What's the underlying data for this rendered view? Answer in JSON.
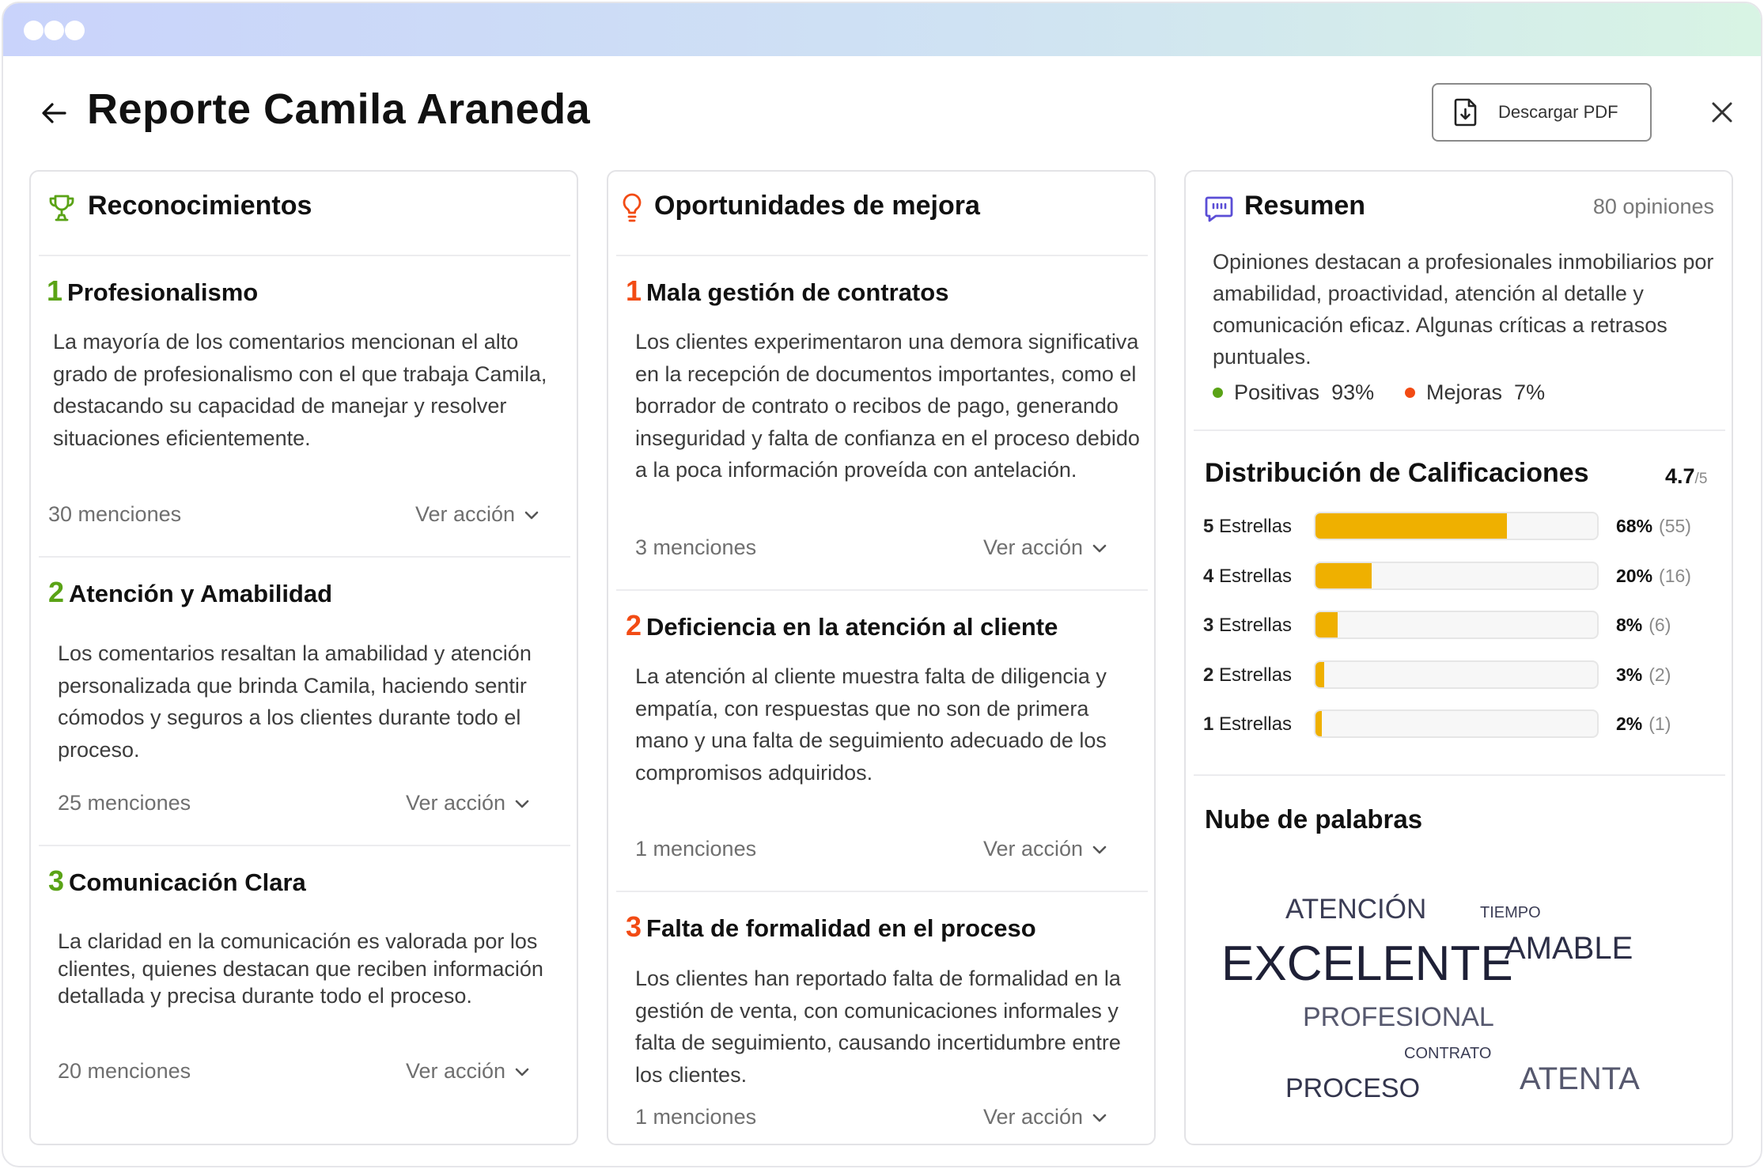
{
  "window": {
    "dots": 3
  },
  "header": {
    "title": "Reporte Camila Araneda",
    "pdf_label": "Descargar PDF"
  },
  "recognitions": {
    "title": "Reconocimientos",
    "items": [
      {
        "num": "1",
        "title": "Profesionalismo",
        "text": "La mayoría de los comentarios mencionan el alto grado de profesionalismo con el que trabaja Camila, destacando su capacidad de manejar y resolver situaciones eficientemente.",
        "mentions": "30 menciones",
        "action": "Ver acción"
      },
      {
        "num": "2",
        "title": "Atención y Amabilidad",
        "text": "Los comentarios resaltan la amabilidad y atención personalizada que brinda Camila, haciendo sentir cómodos y seguros a los clientes durante todo el proceso.",
        "mentions": "25 menciones",
        "action": "Ver acción"
      },
      {
        "num": "3",
        "title": "Comunicación Clara",
        "text": "La claridad en la comunicación es valorada por los clientes, quienes destacan que reciben información detallada y precisa durante todo el proceso.",
        "mentions": "20 menciones",
        "action": "Ver acción"
      }
    ]
  },
  "opportunities": {
    "title": "Oportunidades de mejora",
    "items": [
      {
        "num": "1",
        "title": "Mala gestión de contratos",
        "text": "Los clientes experimentaron una demora significativa en la recepción de documentos importantes, como el borrador de contrato o recibos de pago, generando inseguridad y falta de confianza en el proceso debido a la poca información proveída con antelación.",
        "mentions": "3 menciones",
        "action": "Ver acción"
      },
      {
        "num": "2",
        "title": "Deficiencia en la atención al cliente",
        "text": "La atención al cliente muestra falta de diligencia y empatía, con respuestas que no son de primera mano y una falta de seguimiento adecuado de los compromisos adquiridos.",
        "mentions": "1 menciones",
        "action": "Ver acción"
      },
      {
        "num": "3",
        "title": "Falta de formalidad en el proceso",
        "text": "Los clientes han reportado falta de formalidad en la gestión de venta, con comunicaciones informales y falta de seguimiento, causando incertidumbre entre los clientes.",
        "mentions": "1 menciones",
        "action": "Ver acción"
      }
    ]
  },
  "summary": {
    "title": "Resumen",
    "count": "80 opiniones",
    "text": "Opiniones destacan a profesionales inmobiliarios por amabilidad, proactividad, atención al detalle y comunicación eficaz. Algunas críticas a retrasos puntuales.",
    "positive_label": "Positivas",
    "positive_value": "93%",
    "improve_label": "Mejoras",
    "improve_value": "7%",
    "colors": {
      "positive": "#5aa316",
      "improve": "#f24b14",
      "bar": "#efb000"
    }
  },
  "distribution": {
    "title": "Distribución de Calificaciones",
    "rating": "4.7",
    "rating_suffix": "/5",
    "rows": [
      {
        "num": "5",
        "label": "Estrellas",
        "pct": "68%",
        "count": "(55)",
        "fraction": 0.68
      },
      {
        "num": "4",
        "label": "Estrellas",
        "pct": "20%",
        "count": "(16)",
        "fraction": 0.2
      },
      {
        "num": "3",
        "label": "Estrellas",
        "pct": "8%",
        "count": "(6)",
        "fraction": 0.08
      },
      {
        "num": "2",
        "label": "Estrellas",
        "pct": "3%",
        "count": "(2)",
        "fraction": 0.03
      },
      {
        "num": "1",
        "label": "Estrellas",
        "pct": "2%",
        "count": "(1)",
        "fraction": 0.02
      }
    ]
  },
  "wordcloud": {
    "title": "Nube de palabras",
    "words": [
      "ATENCIÓN",
      "TIEMPO",
      "EXCELENTE",
      "AMABLE",
      "PROFESIONAL",
      "CONTRATO",
      "PROCESO",
      "ATENTA"
    ]
  }
}
